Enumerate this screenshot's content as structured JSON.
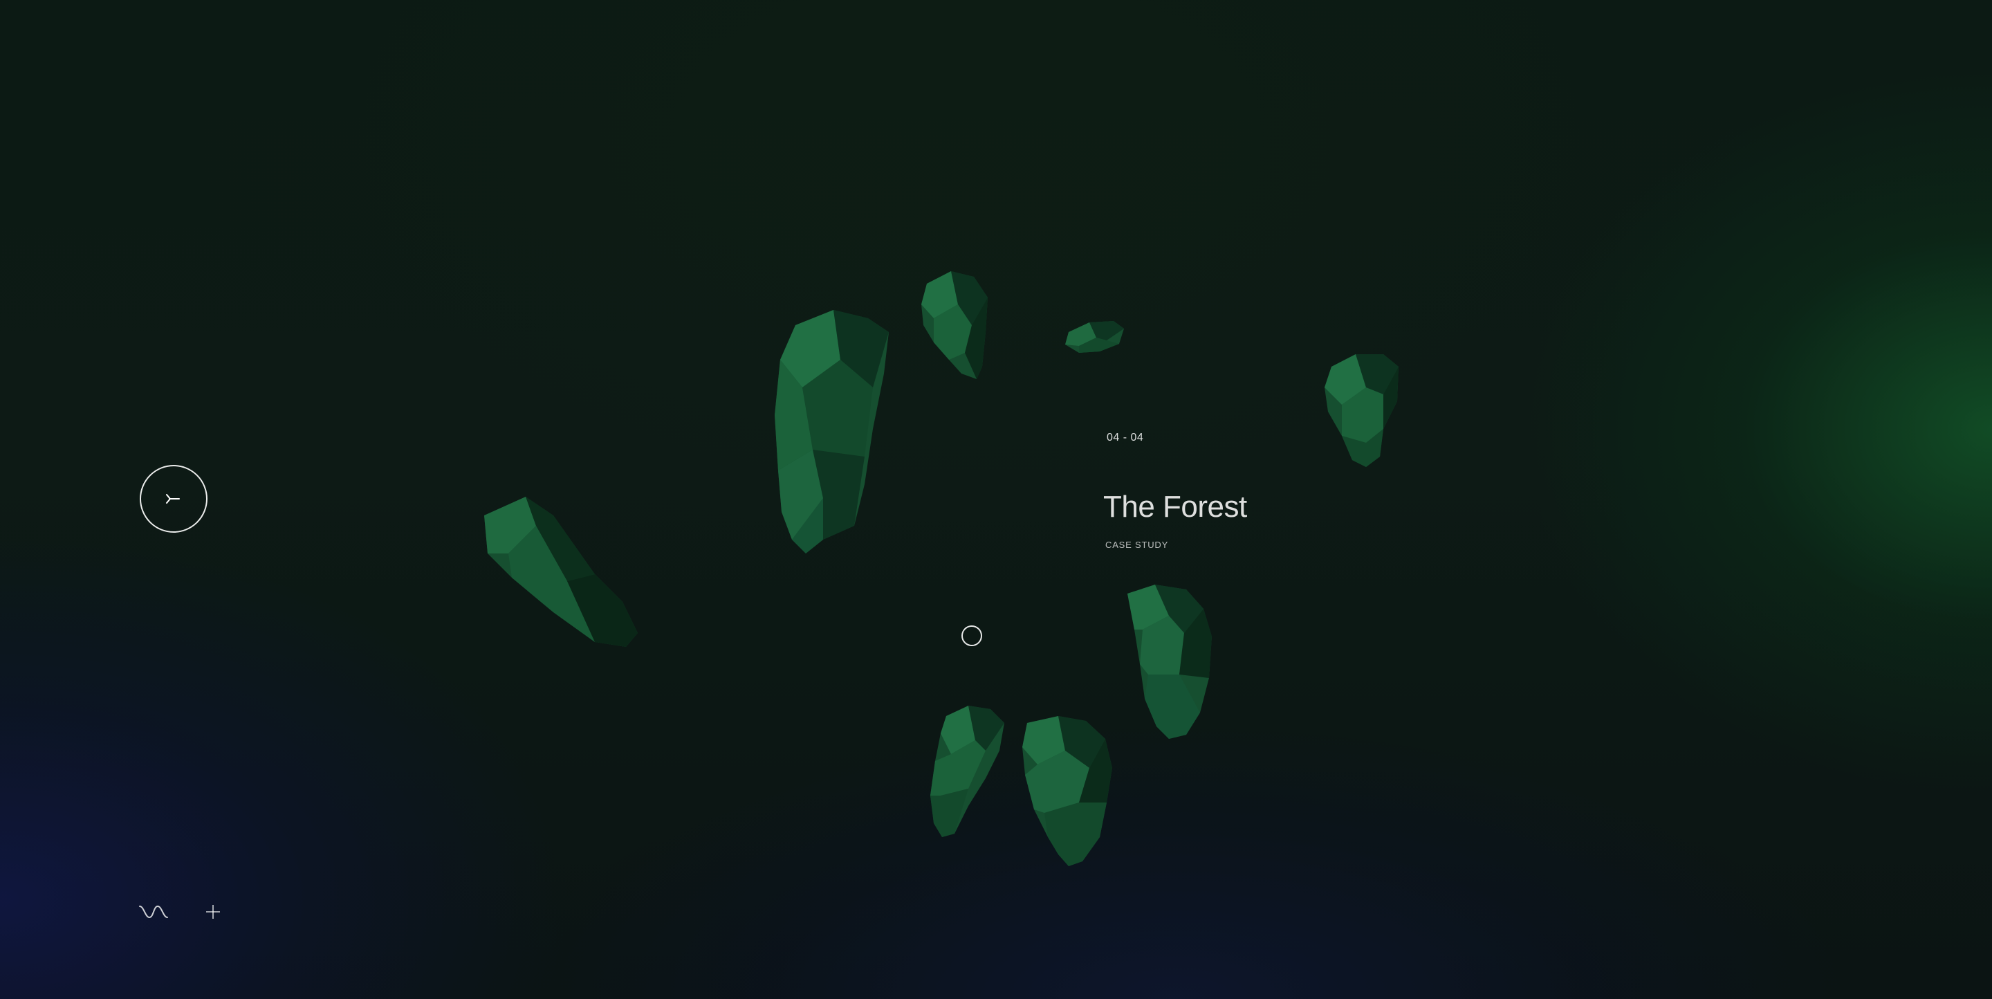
{
  "icons": {
    "menu": "menu-icon",
    "sound": "sound-wave-icon",
    "plus": "plus-icon",
    "cursor": "cursor-ring-icon"
  },
  "project": {
    "counter": "04 - 04",
    "title": "The Forest",
    "subtitle": "CASE STUDY"
  },
  "colors": {
    "rock_light": "#1f6a40",
    "rock_mid": "#164f30",
    "rock_dark": "#0c2f1c",
    "accent_green": "#125428",
    "accent_blue": "#10164a"
  }
}
